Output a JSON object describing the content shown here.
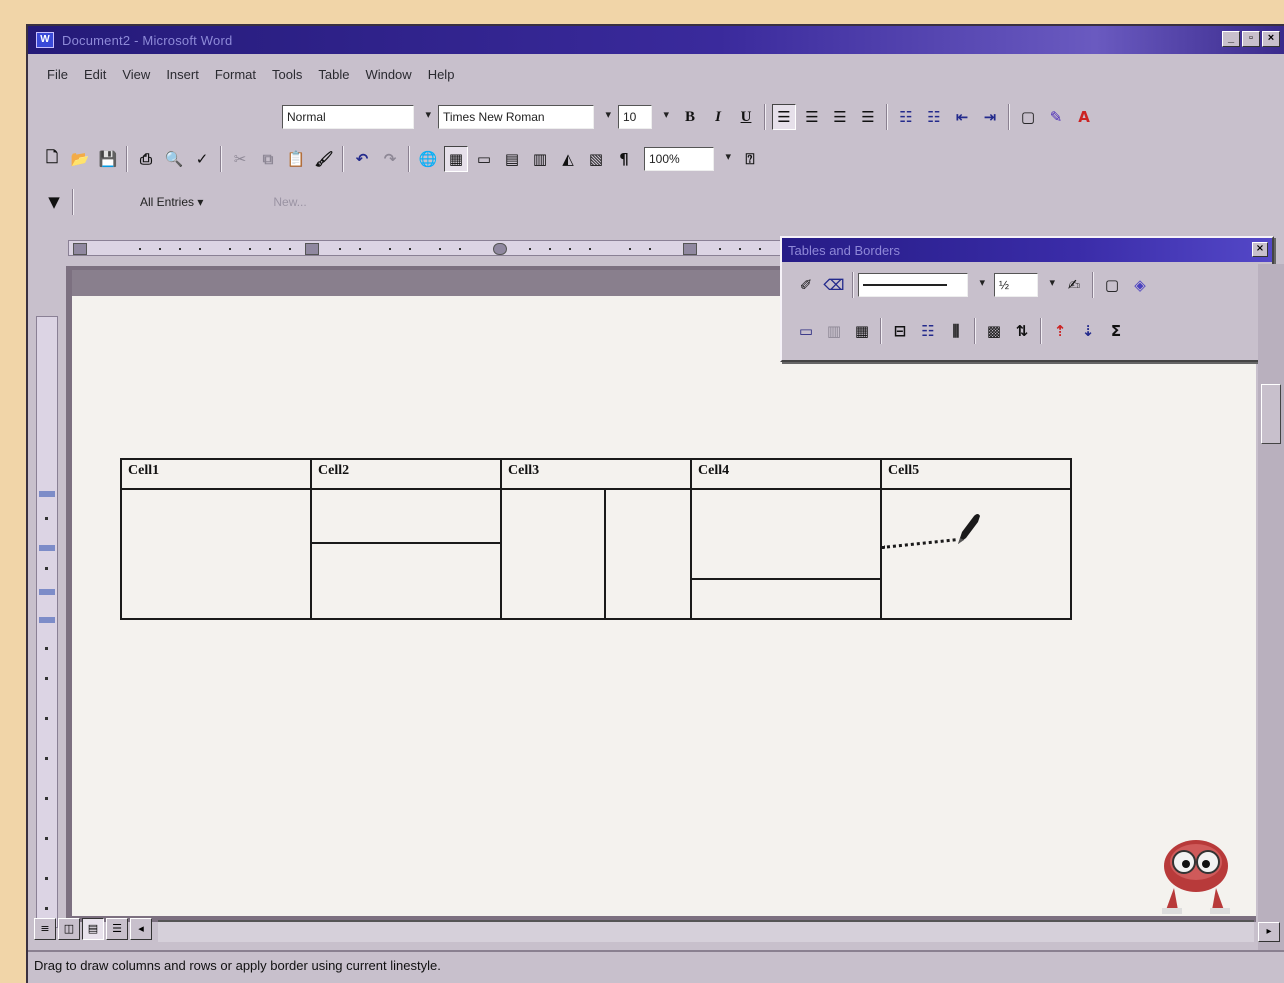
{
  "window": {
    "title": "Document2 - Microsoft Word",
    "controls": [
      "_",
      "▫",
      "×"
    ]
  },
  "menubar": {
    "items": [
      "File",
      "Edit",
      "View",
      "Insert",
      "Format",
      "Tools",
      "Table",
      "Window",
      "Help"
    ]
  },
  "formatting": {
    "style": "Normal",
    "font": "Times New Roman",
    "size": "10",
    "bold": "B",
    "italic": "I",
    "underline": "U"
  },
  "standard": {
    "zoom": "100%"
  },
  "autotext": {
    "all_entries": "All Entries ▾",
    "new": "New..."
  },
  "tables_and_borders": {
    "title": "Tables and Borders",
    "line_weight": "½"
  },
  "document": {
    "table": {
      "headers": [
        "Cell1",
        "Cell2",
        "Cell3",
        "Cell4",
        "Cell5"
      ]
    }
  },
  "statusbar": {
    "text": "Drag to draw columns and rows or apply border using current linestyle."
  },
  "colors": {
    "titlebar": "#241a78",
    "chrome": "#c8c0cc",
    "page": "#f4f2ee",
    "desktop": "#f1d5a8"
  }
}
